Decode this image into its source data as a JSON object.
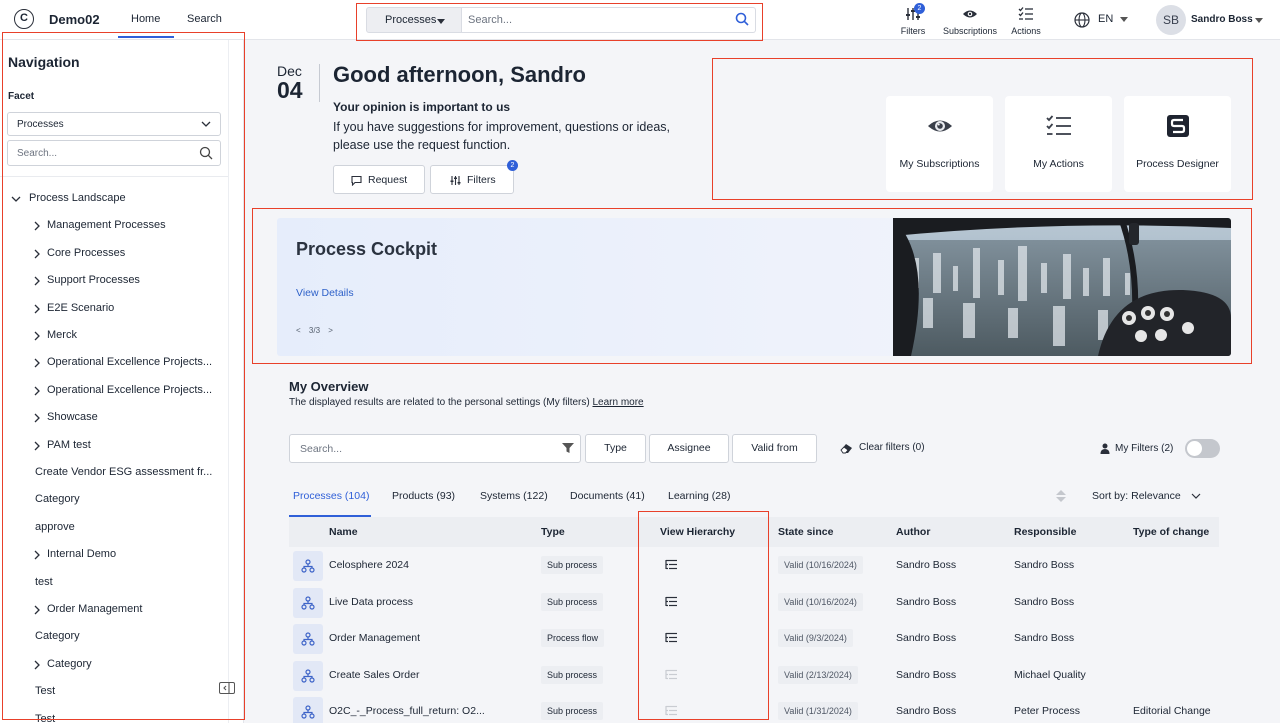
{
  "app": {
    "name": "Demo02",
    "logo_letter": "C"
  },
  "top_nav": [
    {
      "label": "Home",
      "active": true
    },
    {
      "label": "Search",
      "active": false
    }
  ],
  "top_search": {
    "scope": "Processes",
    "placeholder": "Search..."
  },
  "tools": [
    {
      "label": "Filters",
      "icon": "filters-icon",
      "badge": "2"
    },
    {
      "label": "Subscriptions",
      "icon": "eye-icon"
    },
    {
      "label": "Actions",
      "icon": "checklist-icon"
    }
  ],
  "language": {
    "label": "EN"
  },
  "user": {
    "initials": "SB",
    "name": "Sandro Boss"
  },
  "sidebar": {
    "title": "Navigation",
    "facet_label": "Facet",
    "facet_value": "Processes",
    "search_placeholder": "Search...",
    "items": [
      {
        "label": "Process Landscape",
        "level": 0,
        "arrow": "down"
      },
      {
        "label": "Management Processes",
        "level": 1,
        "arrow": "right"
      },
      {
        "label": "Core Processes",
        "level": 1,
        "arrow": "right"
      },
      {
        "label": "Support Processes",
        "level": 1,
        "arrow": "right"
      },
      {
        "label": "E2E Scenario",
        "level": 1,
        "arrow": "right"
      },
      {
        "label": "Merck",
        "level": 1,
        "arrow": "right"
      },
      {
        "label": "Operational Excellence Projects...",
        "level": 1,
        "arrow": "right"
      },
      {
        "label": "Operational Excellence Projects...",
        "level": 1,
        "arrow": "right"
      },
      {
        "label": "Showcase",
        "level": 1,
        "arrow": "right"
      },
      {
        "label": "PAM test",
        "level": 1,
        "arrow": "right"
      },
      {
        "label": "Create Vendor ESG assessment fr...",
        "level": 1,
        "arrow": "none"
      },
      {
        "label": "Category",
        "level": 1,
        "arrow": "none"
      },
      {
        "label": "approve",
        "level": 1,
        "arrow": "none"
      },
      {
        "label": "Internal Demo",
        "level": 1,
        "arrow": "right"
      },
      {
        "label": "test",
        "level": 1,
        "arrow": "none"
      },
      {
        "label": "Order Management",
        "level": 1,
        "arrow": "right"
      },
      {
        "label": "Category",
        "level": 1,
        "arrow": "none"
      },
      {
        "label": "Category",
        "level": 1,
        "arrow": "right"
      },
      {
        "label": "Test",
        "level": 1,
        "arrow": "none"
      },
      {
        "label": "Test",
        "level": 1,
        "arrow": "none"
      }
    ]
  },
  "greeting": {
    "month": "Dec",
    "day": "04",
    "title": "Good afternoon, Sandro",
    "subtitle": "Your opinion is important to us",
    "body": "If you have suggestions for improvement, questions or ideas, please use the request function.",
    "request_label": "Request",
    "filters_label": "Filters",
    "filters_badge": "2"
  },
  "quick_cards": [
    {
      "label": "My Subscriptions",
      "icon": "eye-icon"
    },
    {
      "label": "My Actions",
      "icon": "checklist-icon"
    },
    {
      "label": "Process Designer",
      "icon": "designer-icon"
    }
  ],
  "hero": {
    "title": "Process Cockpit",
    "link": "View Details",
    "pager_prev": "<",
    "pager": "3/3",
    "pager_next": ">"
  },
  "overview": {
    "title": "My Overview",
    "subtitle": "The displayed results are related to the personal settings (My filters)",
    "learn_more": "Learn more",
    "search_placeholder": "Search...",
    "filter_buttons": [
      "Type",
      "Assignee",
      "Valid from"
    ],
    "clear_filters": "Clear filters (0)",
    "my_filters": "My Filters (2)",
    "my_filters_on": false,
    "tabs": [
      {
        "label": "Processes (104)",
        "active": true
      },
      {
        "label": "Products (93)",
        "active": false
      },
      {
        "label": "Systems (122)",
        "active": false
      },
      {
        "label": "Documents (41)",
        "active": false
      },
      {
        "label": "Learning (28)",
        "active": false
      }
    ],
    "sort_label": "Sort  by:",
    "sort_value": "Relevance",
    "columns": [
      "Name",
      "Type",
      "View Hierarchy",
      "State since",
      "Author",
      "Responsible",
      "Type of change"
    ],
    "rows": [
      {
        "name": "Celosphere 2024",
        "type": "Sub process",
        "hierarchy": true,
        "state": "Valid (10/16/2024)",
        "author": "Sandro Boss",
        "responsible": "Sandro Boss",
        "change": ""
      },
      {
        "name": "Live Data process",
        "type": "Sub process",
        "hierarchy": true,
        "state": "Valid (10/16/2024)",
        "author": "Sandro Boss",
        "responsible": "Sandro Boss",
        "change": ""
      },
      {
        "name": "Order Management",
        "type": "Process flow",
        "hierarchy": true,
        "state": "Valid (9/3/2024)",
        "author": "Sandro Boss",
        "responsible": "Sandro Boss",
        "change": ""
      },
      {
        "name": "Create Sales Order",
        "type": "Sub process",
        "hierarchy": false,
        "state": "Valid (2/13/2024)",
        "author": "Sandro Boss",
        "responsible": "Michael Quality",
        "change": ""
      },
      {
        "name": "O2C_-_Process_full_return: O2...",
        "type": "Sub process",
        "hierarchy": false,
        "state": "Valid (1/31/2024)",
        "author": "Sandro Boss",
        "responsible": "Peter Process",
        "change": "Editorial Change"
      }
    ]
  },
  "colors": {
    "accent": "#2f5fd8",
    "highlight": "#e8402a",
    "background": "#f4f5f8"
  }
}
